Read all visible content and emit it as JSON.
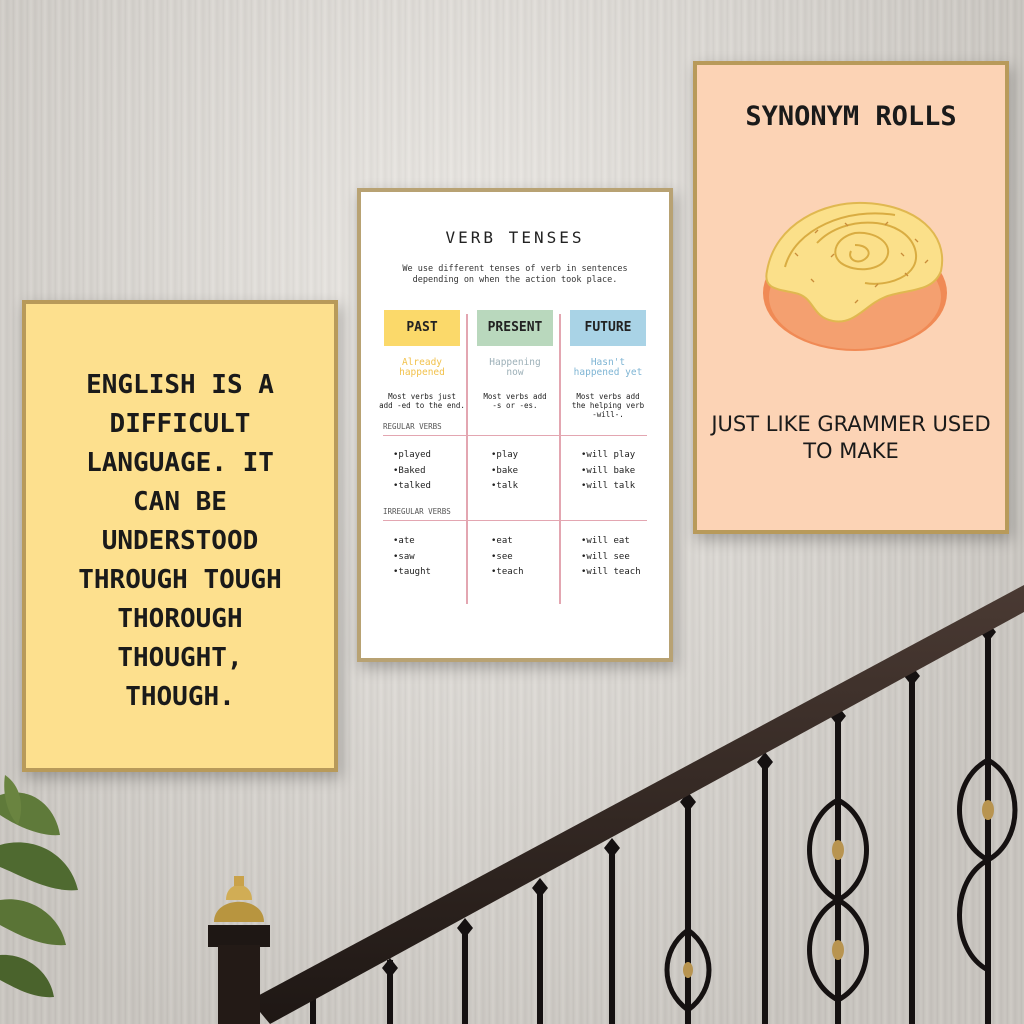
{
  "poster_left": {
    "lines": [
      "ENGLISH IS A",
      "DIFFICULT",
      "LANGUAGE. IT",
      "CAN BE",
      "UNDERSTOOD",
      "THROUGH TOUGH",
      "THOROUGH",
      "THOUGHT,",
      "THOUGH."
    ],
    "background": "#fde08e"
  },
  "poster_middle": {
    "title": "VERB TENSES",
    "intro_line1": "We use different tenses of verb in sentences",
    "intro_line2": "depending on when the action took place.",
    "columns": [
      {
        "tag": "PAST",
        "tag_color": "#fbd96a",
        "sub_line1": "Already",
        "sub_line2": "happened",
        "sub_color": "#f2c24d",
        "rule_line1": "Most verbs just",
        "rule_line2": "add -ed to the end.",
        "regular": [
          "played",
          "Baked",
          "talked"
        ],
        "irregular": [
          "ate",
          "saw",
          "taught"
        ]
      },
      {
        "tag": "PRESENT",
        "tag_color": "#b9d8bd",
        "sub_line1": "Happening",
        "sub_line2": "now",
        "sub_color": "#9db0b8",
        "rule_line1": "Most verbs add",
        "rule_line2": "-s or -es.",
        "regular": [
          "play",
          "bake",
          "talk"
        ],
        "irregular": [
          "eat",
          "see",
          "teach"
        ]
      },
      {
        "tag": "FUTURE",
        "tag_color": "#a9d3e6",
        "sub_line1": "Hasn't",
        "sub_line2": "happened yet",
        "sub_color": "#7fb5d4",
        "rule_line1": "Most verbs add",
        "rule_line2": "the helping verb",
        "rule_line3": "-will-.",
        "regular": [
          "will play",
          "will bake",
          "will talk"
        ],
        "irregular": [
          "will eat",
          "will see",
          "will teach"
        ]
      }
    ],
    "section_regular": "REGULAR VERBS",
    "section_irregular": "IRREGULAR VERBS"
  },
  "poster_right": {
    "title": "SYNONYM ROLLS",
    "caption_line1": "JUST LIKE GRAMMER USED",
    "caption_line2": "TO MAKE",
    "background": "#fcd3b5",
    "icon": "cinnamon-roll-icon"
  },
  "scene": {
    "frame_color": "#b89a5a",
    "railing_color": "#2b211d"
  }
}
